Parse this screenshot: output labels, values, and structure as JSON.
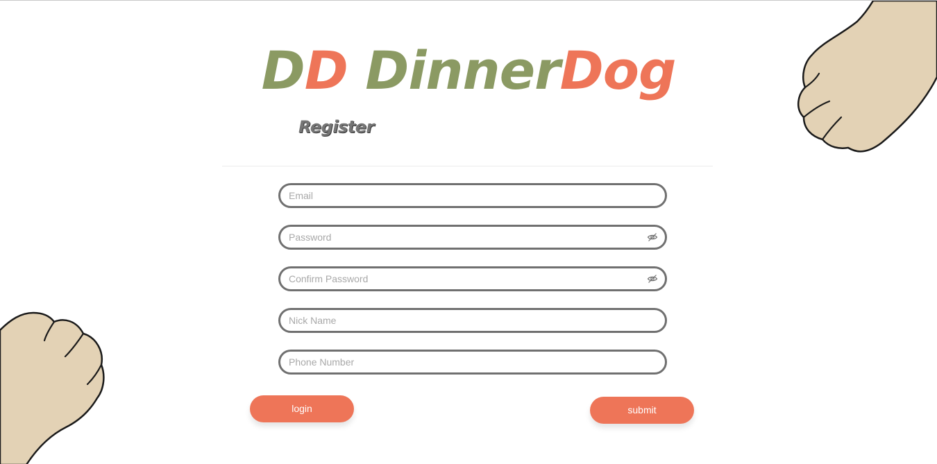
{
  "logo": {
    "part1": "D",
    "part2": "D",
    "part3": " Dinner",
    "part4": "Dog"
  },
  "form": {
    "title": "Register",
    "fields": {
      "email": {
        "placeholder": "Email",
        "value": ""
      },
      "password": {
        "placeholder": "Password",
        "value": ""
      },
      "confirm_password": {
        "placeholder": "Confirm Password",
        "value": ""
      },
      "nick_name": {
        "placeholder": "Nick Name",
        "value": ""
      },
      "phone_number": {
        "placeholder": "Phone Number",
        "value": ""
      }
    },
    "login_label": "login",
    "submit_label": "submit"
  },
  "colors": {
    "logo_green": "#8b9a63",
    "accent_orange": "#ee7558",
    "field_border": "#707070",
    "paw_fill": "#e3d2b5"
  },
  "icons": {
    "password_toggle": "eye-slash-icon",
    "decor": "paw-illustration"
  }
}
